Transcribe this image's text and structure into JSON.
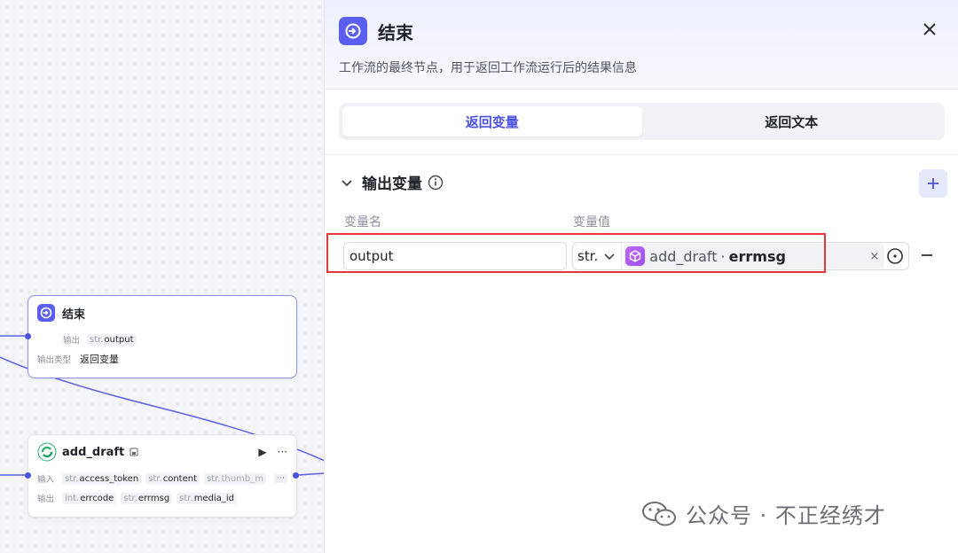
{
  "canvas": {
    "end_node": {
      "title": "结束",
      "output_label": "输出",
      "output_tag_type": "str.",
      "output_tag_name": "output",
      "output_type_label": "输出类型",
      "output_type_value": "返回变量"
    },
    "draft_node": {
      "title": "add_draft",
      "input_label": "输入",
      "inputs": [
        {
          "type": "str.",
          "name": "access_token"
        },
        {
          "type": "str.",
          "name": "content"
        },
        {
          "type": "str.",
          "name": "thumb_m"
        }
      ],
      "more": "···",
      "output_label": "输出",
      "outputs": [
        {
          "type": "int.",
          "name": "errcode"
        },
        {
          "type": "str.",
          "name": "errmsg"
        },
        {
          "type": "str.",
          "name": "media_id"
        }
      ],
      "run_icon": "▶",
      "menu_icon": "···"
    }
  },
  "panel": {
    "title": "结束",
    "description": "工作流的最终节点，用于返回工作流运行后的结果信息",
    "tabs": [
      {
        "label": "返回变量",
        "active": true
      },
      {
        "label": "返回文本",
        "active": false
      }
    ],
    "section_title": "输出变量",
    "col_name": "变量名",
    "col_value": "变量值",
    "row": {
      "name": "output",
      "type": "str.",
      "ref_node": "add_draft",
      "ref_sep": "·",
      "ref_field": "errmsg",
      "clear": "×"
    }
  },
  "watermark": {
    "text": "公众号 · 不正经绣才"
  },
  "colors": {
    "accent": "#4c52e0",
    "highlight": "#e5383b",
    "node_icon": "#5a5ff0"
  }
}
